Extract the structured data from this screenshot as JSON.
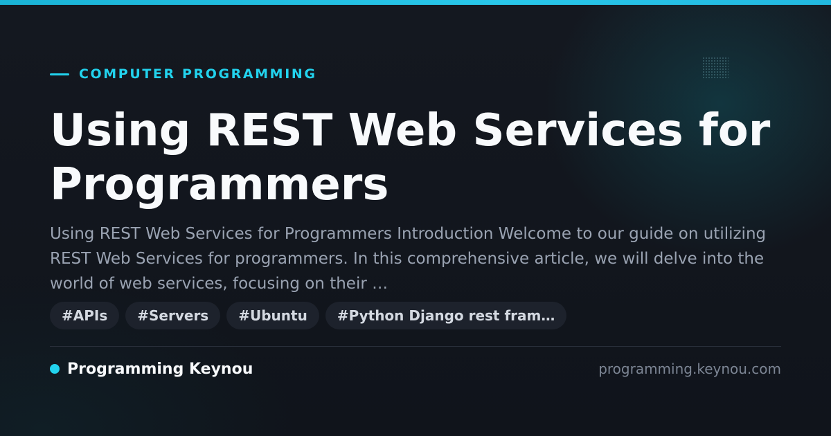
{
  "category": "COMPUTER PROGRAMMING",
  "title": "Using REST Web Services for Programmers",
  "description": "Using REST Web Services for Programmers Introduction Welcome to our guide on utilizing REST Web Services for programmers. In this comprehensive article, we will delve into the world of web services, focusing on their …",
  "tags": [
    "#APIs",
    "#Servers",
    "#Ubuntu",
    "#Python Django rest fram…"
  ],
  "brand": {
    "name": "Programming Keynou",
    "domain": "programming.keynou.com"
  },
  "colors": {
    "accent": "#22d3ee",
    "background": "#12161e",
    "title": "#f8fafc",
    "description": "#9aa3b2",
    "tag_background": "#1d222c"
  }
}
